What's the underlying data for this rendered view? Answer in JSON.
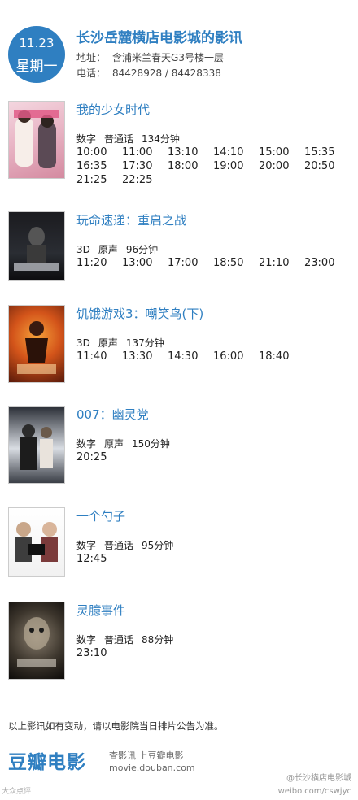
{
  "header": {
    "date": "11.23",
    "weekday": "星期一",
    "cinema_name": "长沙岳麓横店电影城的影讯",
    "address_label": "地址：",
    "address": "含浦米兰春天G3号楼一层",
    "phone_label": "电话：",
    "phone": "84428928 / 84428338"
  },
  "movies": [
    {
      "title": "我的少女时代",
      "format": "数字",
      "language": "普通话",
      "duration": "134分钟",
      "times": [
        "10:00",
        "11:00",
        "13:10",
        "14:10",
        "15:00",
        "15:35",
        "16:35",
        "17:30",
        "18:00",
        "19:00",
        "20:00",
        "20:50",
        "21:25",
        "22:25"
      ]
    },
    {
      "title": "玩命速递：重启之战",
      "format": "3D",
      "language": "原声",
      "duration": "96分钟",
      "times": [
        "11:20",
        "13:00",
        "17:00",
        "18:50",
        "21:10",
        "23:00"
      ]
    },
    {
      "title": "饥饿游戏3：嘲笑鸟(下)",
      "format": "3D",
      "language": "原声",
      "duration": "137分钟",
      "times": [
        "11:40",
        "13:30",
        "14:30",
        "16:00",
        "18:40"
      ]
    },
    {
      "title": "007：幽灵党",
      "format": "数字",
      "language": "原声",
      "duration": "150分钟",
      "times": [
        "20:25"
      ]
    },
    {
      "title": "一个勺子",
      "format": "数字",
      "language": "普通话",
      "duration": "95分钟",
      "times": [
        "12:45"
      ]
    },
    {
      "title": "灵臆事件",
      "format": "数字",
      "language": "普通话",
      "duration": "88分钟",
      "times": [
        "23:10"
      ]
    }
  ],
  "footer": {
    "note": "以上影讯如有变动，请以电影院当日排片公告为准。",
    "logo": "豆瓣电影",
    "slogan": "查影讯 上豆瓣电影",
    "url": "movie.douban.com",
    "watermark_left": "大众点评",
    "watermark_right_1": "@长沙横店电影城",
    "watermark_right_2": "weibo.com/cswjyc"
  },
  "colors": {
    "accent": "#2f7fc1"
  }
}
